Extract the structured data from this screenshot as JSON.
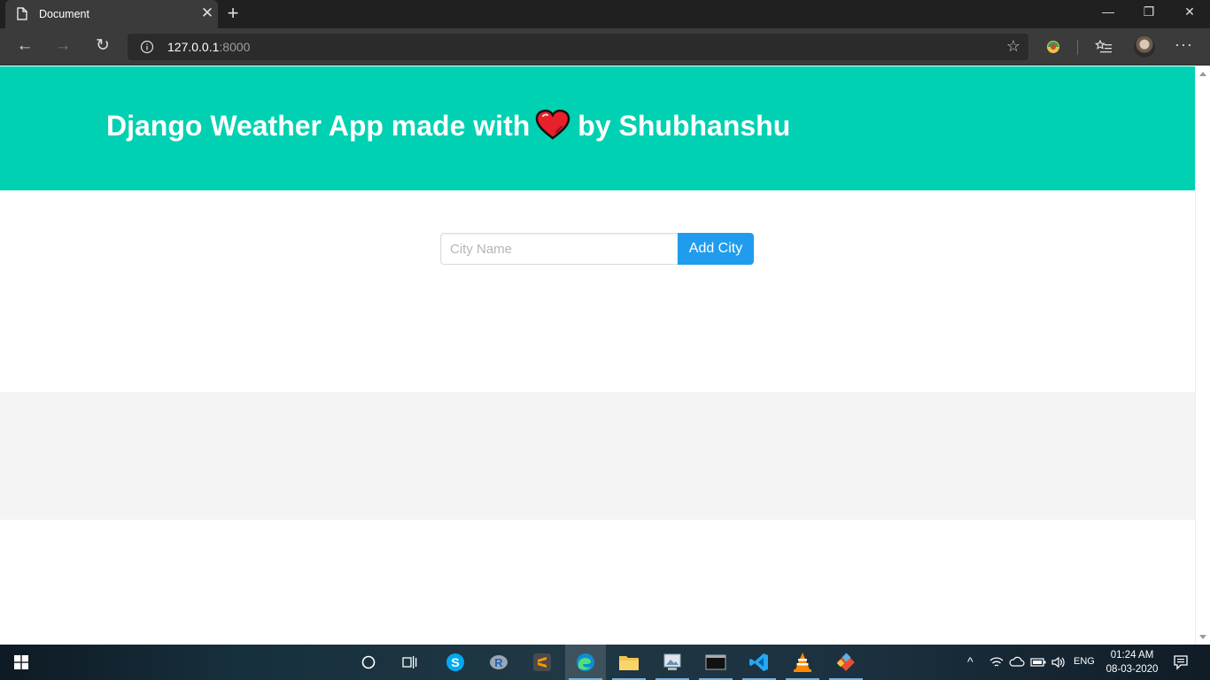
{
  "browser": {
    "tab_title": "Document",
    "tab_close": "✕",
    "new_tab": "+",
    "window_controls": {
      "minimize": "—",
      "restore": "❐",
      "close": "✕"
    },
    "nav": {
      "back": "←",
      "forward": "→",
      "refresh": "↻"
    },
    "url_host": "127.0.0.1",
    "url_port": ":8000",
    "star": "☆",
    "more": "···"
  },
  "page": {
    "title_before": "Django Weather App made with",
    "title_after": "by Shubhanshu",
    "input_placeholder": "City Name",
    "button_label": "Add City",
    "colors": {
      "hero": "#00d1b2",
      "button": "#209cee",
      "band": "#f4f4f4"
    }
  },
  "taskbar": {
    "icons": [
      "windows-start-icon",
      "cortana-search-icon",
      "task-view-icon",
      "skype-icon",
      "r-icon",
      "sublime-text-icon",
      "edge-icon",
      "file-explorer-icon",
      "photos-icon",
      "terminal-icon",
      "vscode-icon",
      "vlc-icon",
      "git-icon"
    ],
    "language": "ENG",
    "time": "01:24 AM",
    "date": "08-03-2020"
  }
}
